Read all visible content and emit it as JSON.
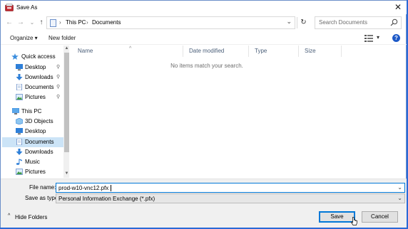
{
  "window": {
    "title": "Save As",
    "close_glyph": "✕"
  },
  "nav_buttons": {
    "back": "←",
    "forward": "→",
    "recent": "⌄",
    "up": "↑"
  },
  "address": {
    "crumbs": [
      "This PC",
      "Documents"
    ],
    "separator": "›",
    "dropdown_glyph": "⌄",
    "refresh_glyph": "↻"
  },
  "search": {
    "placeholder": "Search Documents"
  },
  "toolbar": {
    "organize_label": "Organize ▾",
    "new_folder_label": "New folder",
    "view_dropdown": "▾",
    "help_glyph": "?"
  },
  "nav_pane": {
    "items": [
      {
        "label": "Quick access",
        "icon": "star-icon"
      },
      {
        "label": "Desktop",
        "icon": "desktop-icon",
        "pinned": true
      },
      {
        "label": "Downloads",
        "icon": "download-icon",
        "pinned": true
      },
      {
        "label": "Documents",
        "icon": "documents-icon",
        "pinned": true
      },
      {
        "label": "Pictures",
        "icon": "pictures-icon",
        "pinned": true
      },
      {
        "label": "This PC",
        "icon": "computer-icon"
      },
      {
        "label": "3D Objects",
        "icon": "cube-icon"
      },
      {
        "label": "Desktop",
        "icon": "desktop-icon"
      },
      {
        "label": "Documents",
        "icon": "documents-icon",
        "selected": true
      },
      {
        "label": "Downloads",
        "icon": "download-icon"
      },
      {
        "label": "Music",
        "icon": "music-icon"
      },
      {
        "label": "Pictures",
        "icon": "pictures-icon"
      }
    ],
    "pin_glyph": "📌"
  },
  "columns": {
    "name": "Name",
    "date": "Date modified",
    "type": "Type",
    "size": "Size"
  },
  "empty_message": "No items match your search.",
  "form": {
    "file_name_label": "File name:",
    "file_name_value": "prod-w10-vnc12.pfx",
    "save_type_label": "Save as type:",
    "save_type_value": "Personal Information Exchange (*.pfx)"
  },
  "footer": {
    "hide_folders_label": "Hide Folders",
    "save_label": "Save",
    "cancel_label": "Cancel"
  },
  "colors": {
    "accent": "#0078d7",
    "selection": "#cce4f7",
    "help": "#1d59c7"
  }
}
